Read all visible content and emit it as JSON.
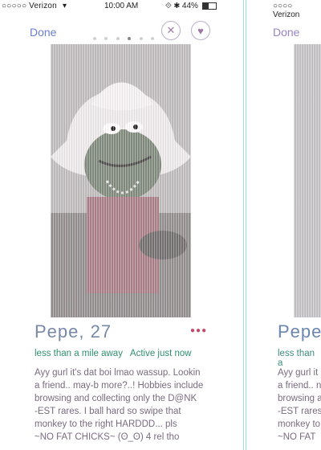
{
  "status_bar": {
    "carrier": "○○○○○ Verizon",
    "time": "10:00 AM",
    "battery_text": "44%",
    "wifi_icon": "wifi-icon",
    "alarm_icon": "alarm-icon",
    "bluetooth_icon": "bluetooth-icon",
    "battery_level": 0.44
  },
  "nav": {
    "done_label": "Done",
    "page_dots": {
      "count": 6,
      "active_index": 3
    },
    "close_icon": "close-x-icon",
    "like_icon": "heart-icon"
  },
  "profile": {
    "name": "Pepe, 27",
    "distance": "less than a mile away",
    "activity": "Active just now",
    "bio_lines": [
      "Ayy gurl it's dat boi lmao wassup. Lookin",
      "a friend.. may-b more?..! Hobbies include",
      "browsing and collecting only the D@NK",
      "-EST rares. I ball hard so swipe that",
      "monkey to the right HARDDD... pls",
      "~NO FAT CHICKS~ (ʘ_ʘ) 4 rel tho"
    ],
    "more_icon": "more-options-icon"
  },
  "panel2": {
    "carrier": "○○○○ Verizon",
    "done_label": "Done",
    "name": "Pepe, ",
    "distance": "less than a",
    "bio_lines": [
      "Ayy gurl it",
      "a friend.. n",
      "browsing a",
      "-EST rares",
      "monkey to",
      "~NO FAT"
    ]
  },
  "colors": {
    "accent": "#6c7fd0",
    "meta_green": "#2f8f6f",
    "more_dots": "#c24b6c"
  }
}
